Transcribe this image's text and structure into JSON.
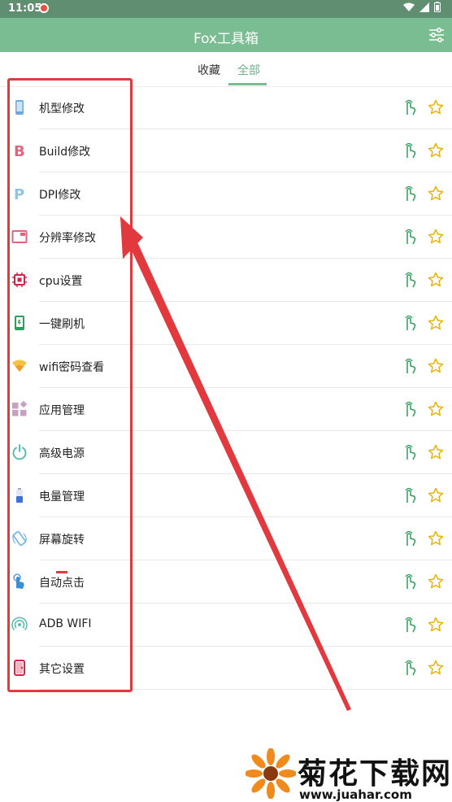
{
  "status_bar": {
    "time": "11:05"
  },
  "app_bar": {
    "title": "Fox工具箱"
  },
  "tabs": [
    {
      "label": "收藏",
      "active": false
    },
    {
      "label": "全部",
      "active": true
    }
  ],
  "accent_color": "#7abd92",
  "items": [
    {
      "label": "机型修改",
      "icon": "phone-icon"
    },
    {
      "label": "Build修改",
      "icon": "letter-b-icon"
    },
    {
      "label": "DPI修改",
      "icon": "letter-p-icon"
    },
    {
      "label": "分辨率修改",
      "icon": "screen-window-icon"
    },
    {
      "label": "cpu设置",
      "icon": "cpu-chip-icon"
    },
    {
      "label": "一键刷机",
      "icon": "flash-phone-icon"
    },
    {
      "label": "wifi密码查看",
      "icon": "wifi-icon"
    },
    {
      "label": "应用管理",
      "icon": "apps-grid-icon"
    },
    {
      "label": "高级电源",
      "icon": "power-icon"
    },
    {
      "label": "电量管理",
      "icon": "battery-icon"
    },
    {
      "label": "屏幕旋转",
      "icon": "rotate-screen-icon"
    },
    {
      "label": "自动点击",
      "icon": "tap-hand-icon"
    },
    {
      "label": "ADB WIFI",
      "icon": "broadcast-icon"
    },
    {
      "label": "其它设置",
      "icon": "other-settings-icon"
    }
  ],
  "watermark": {
    "text": "菊花下载网",
    "url": "www.juahar.com"
  }
}
